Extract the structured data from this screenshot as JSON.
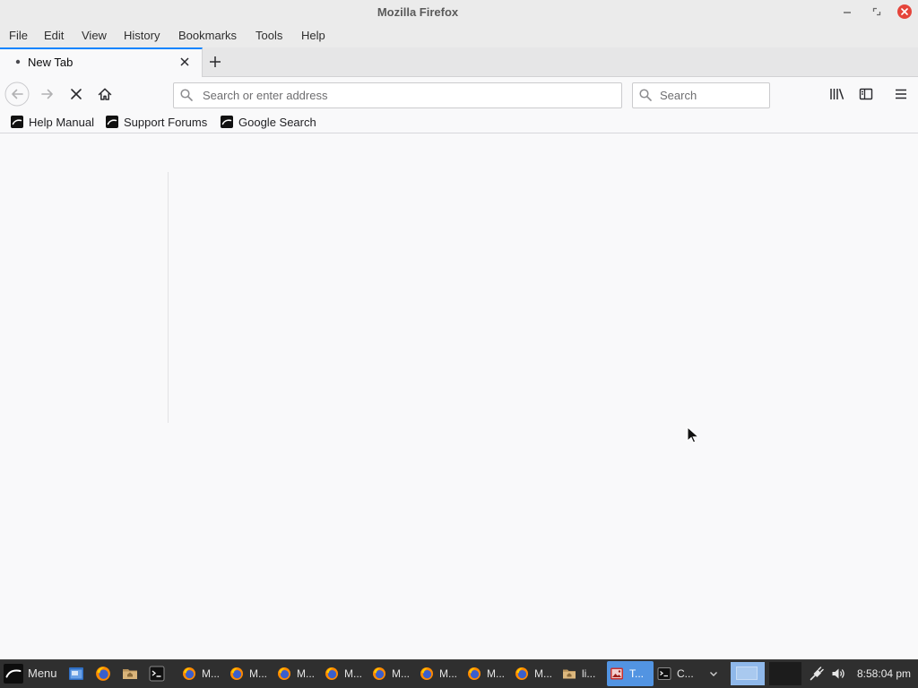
{
  "window": {
    "title": "Mozilla Firefox",
    "minimize_icon": "minimize-icon",
    "maximize_icon": "maximize-icon",
    "close_icon": "close-icon"
  },
  "menubar": {
    "items": [
      "File",
      "Edit",
      "View",
      "History",
      "Bookmarks",
      "Tools",
      "Help"
    ]
  },
  "tabs": {
    "items": [
      {
        "label": "New Tab",
        "active": true,
        "icon": "tab-loading-icon",
        "close_icon": "tab-close-icon"
      }
    ],
    "new_tab_icon": "new-tab-plus-icon"
  },
  "navbar": {
    "back": {
      "icon": "back-arrow-icon",
      "enabled": false
    },
    "forward": {
      "icon": "forward-arrow-icon",
      "enabled": false
    },
    "stop": {
      "icon": "stop-icon"
    },
    "home": {
      "icon": "home-icon"
    },
    "urlbar": {
      "value": "",
      "placeholder": "Search or enter address",
      "icon": "search-icon"
    },
    "searchbar": {
      "value": "",
      "placeholder": "Search",
      "icon": "search-icon"
    },
    "library_icon": "library-icon",
    "sidebar_icon": "sidebar-icon",
    "menu_icon": "hamburger-menu-icon"
  },
  "bookmarks_toolbar": {
    "items": [
      {
        "label": "Help Manual",
        "icon": "bookmark-favicon-icon"
      },
      {
        "label": "Support Forums",
        "icon": "bookmark-favicon-icon"
      },
      {
        "label": "Google Search",
        "icon": "bookmark-favicon-icon"
      }
    ]
  },
  "taskbar": {
    "menu": {
      "label": "Menu",
      "icon": "menu-logo-icon"
    },
    "launchers": [
      {
        "icon": "show-desktop-icon"
      },
      {
        "icon": "firefox-icon"
      },
      {
        "icon": "home-folder-icon"
      },
      {
        "icon": "terminal-icon"
      }
    ],
    "tasks": [
      {
        "label": "M...",
        "icon": "firefox-icon",
        "active": false
      },
      {
        "label": "M...",
        "icon": "firefox-icon",
        "active": false
      },
      {
        "label": "M...",
        "icon": "firefox-icon",
        "active": false
      },
      {
        "label": "M...",
        "icon": "firefox-icon",
        "active": false
      },
      {
        "label": "M...",
        "icon": "firefox-icon",
        "active": false
      },
      {
        "label": "M...",
        "icon": "firefox-icon",
        "active": false
      },
      {
        "label": "M...",
        "icon": "firefox-icon",
        "active": false
      },
      {
        "label": "M...",
        "icon": "firefox-icon",
        "active": false
      },
      {
        "label": "li...",
        "icon": "folder-icon",
        "active": false
      },
      {
        "label": "T...",
        "icon": "image-viewer-icon",
        "active": true
      },
      {
        "label": "C...",
        "icon": "terminal-icon",
        "active": false
      }
    ],
    "overflow_icon": "chevron-down-icon",
    "workspaces": [
      {
        "active": true
      },
      {
        "active": false
      }
    ],
    "tray": {
      "network_icon": "network-icon",
      "volume_icon": "volume-icon"
    },
    "clock": "8:58:04 pm"
  },
  "colors": {
    "accent": "#0a84ff",
    "close_button": "#e5443a",
    "taskbar_bg": "#2f2f2f",
    "taskbar_active": "#5294e2",
    "content_bg": "#f9f9fa"
  }
}
